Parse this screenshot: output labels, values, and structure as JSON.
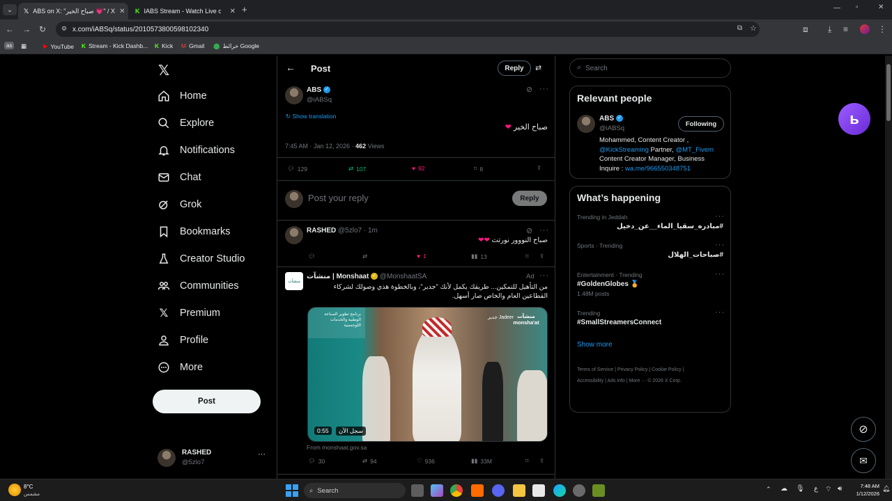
{
  "browser": {
    "tabs": [
      {
        "title": "ABS on X: \"صباح الخير 💗\" / X",
        "active": true
      },
      {
        "title": "IABS Stream - Watch Live on Kick",
        "active": false
      }
    ],
    "url": "x.com/iABSq/status/2010573800598102340",
    "bookmarks": [
      "YouTube",
      "Stream - Kick Dashb...",
      "Kick",
      "Gmail",
      "خرائط Google"
    ]
  },
  "sidebar": {
    "items": [
      {
        "label": "Home"
      },
      {
        "label": "Explore"
      },
      {
        "label": "Notifications"
      },
      {
        "label": "Chat"
      },
      {
        "label": "Grok"
      },
      {
        "label": "Bookmarks"
      },
      {
        "label": "Creator Studio"
      },
      {
        "label": "Communities"
      },
      {
        "label": "Premium"
      },
      {
        "label": "Profile"
      },
      {
        "label": "More"
      }
    ],
    "post_label": "Post",
    "account": {
      "name": "RASHED",
      "handle": "@5zlo7"
    }
  },
  "header": {
    "title": "Post",
    "reply_label": "Reply"
  },
  "post": {
    "author": "ABS",
    "handle": "@iABSq",
    "show_translation": "Show translation",
    "text": "صباح الخير",
    "time": "7:45 AM · Jan 12, 2026 ·",
    "views_count": "462",
    "views_label": "Views",
    "replies": "129",
    "reposts": "107",
    "likes": "92",
    "bookmarks": "8"
  },
  "composer": {
    "placeholder": "Post your reply",
    "button": "Reply"
  },
  "reply": {
    "author": "RASHED",
    "handle": "@5zlo7 · 1m",
    "text": "صباح النووور نورتت",
    "likes": "1",
    "views": "13"
  },
  "ad": {
    "author": "منشآت | Monshaat",
    "handle": "@MonshaatSA",
    "ad_label": "Ad",
    "text": "من التأهيل للتمكين... طريقك يكمل لأنك \"جدير\"، وبالخطوة هذي وصولك لشركاء القطاعين العام والخاص صار أسهل.",
    "video_duration": "0:55",
    "video_cta": "سجل الآن",
    "brand_logo": "منشآت monsha'at",
    "brand_jadeer": "جدير Jadeer",
    "program_text": "برنامج تطوير الصناعة الوطنية والخدمات اللوجستية",
    "source": "From monshaat.gov.sa",
    "replies": "30",
    "reposts": "94",
    "likes": "936",
    "views": "33M"
  },
  "right": {
    "search_placeholder": "Search",
    "relevant_title": "Relevant people",
    "person": {
      "name": "ABS",
      "handle": "@iABSq",
      "follow_label": "Following",
      "bio_1": "Mohammed, Content Creator ,",
      "bio_link_1": "@KickStreaming",
      "bio_2": " Partner, ",
      "bio_link_2": "@MT_Fivem",
      "bio_3": "Content Creator Manager, Business Inquire : ",
      "bio_link_3": "wa.me/966550348751"
    },
    "happening_title": "What’s happening",
    "trends": [
      {
        "context": "Trending in Jeddah",
        "name": "#مبادره_سقيا_الماء__عن_دخيل",
        "posts": ""
      },
      {
        "context": "Sports · Trending",
        "name": "#صباحات_الهلال",
        "posts": ""
      },
      {
        "context": "Entertainment · Trending",
        "name": "#GoldenGlobes 🏅",
        "posts": "1.48M posts"
      },
      {
        "context": "Trending",
        "name": "#SmallStreamersConnect",
        "posts": ""
      }
    ],
    "show_more": "Show more",
    "footer_1": "Terms of Service  |  Privacy Policy  |  Cookie Policy  |",
    "footer_2": "Accessibility  |  Ads info  |  More ···  © 2026 X Corp."
  },
  "taskbar": {
    "weather_temp": "8°C",
    "weather_desc": "مشمس",
    "search_label": "Search",
    "time": "7:48 AM",
    "date": "1/12/2026",
    "lang": "ع"
  },
  "colors": {
    "accent": "#1d9bf0",
    "like": "#f91880",
    "repost": "#00ba7c",
    "background": "#000000"
  }
}
